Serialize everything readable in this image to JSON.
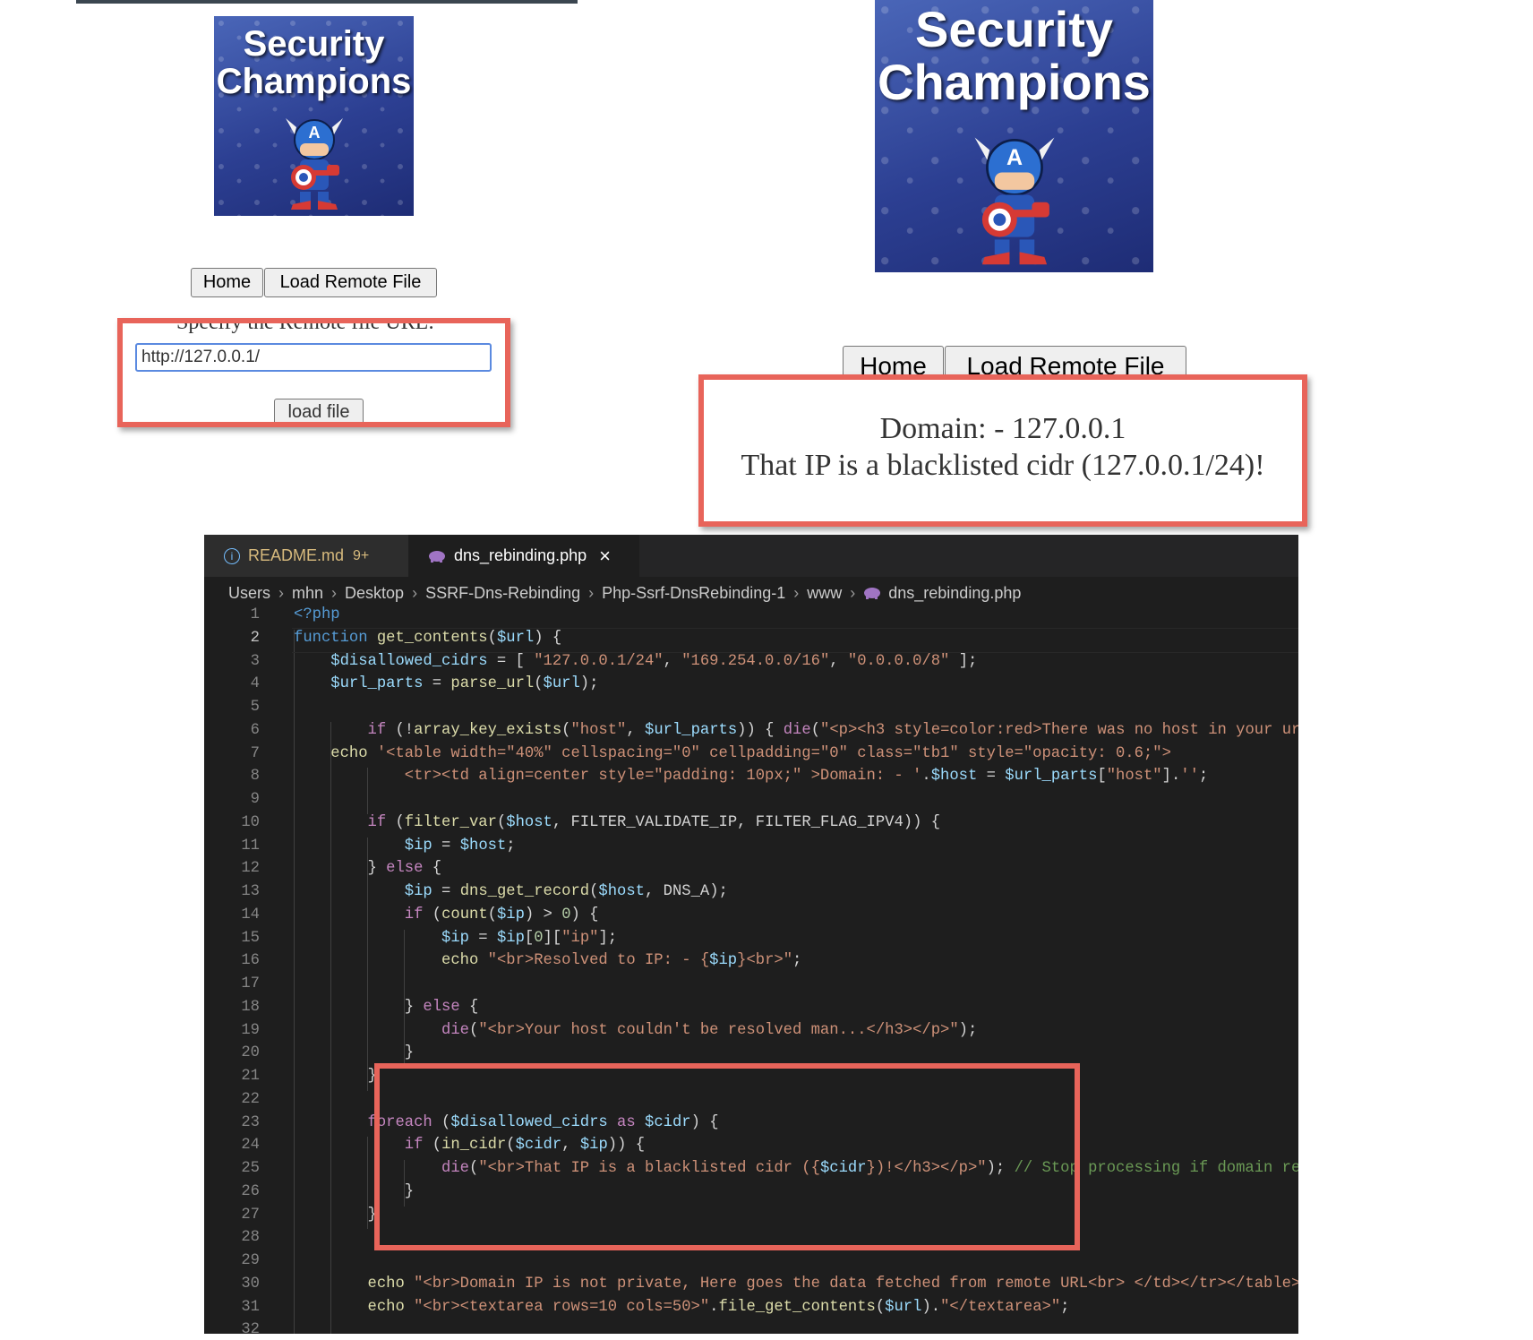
{
  "left_panel": {
    "logo_line1": "Security",
    "logo_line2": "Champions",
    "nav_home": "Home",
    "nav_load": "Load Remote File",
    "prompt_text": "Specify the Remote file URL:",
    "url_value": "http://127.0.0.1/",
    "load_button": "load file"
  },
  "right_panel": {
    "logo_line1": "Security",
    "logo_line2": "Champions",
    "nav_home": "Home",
    "nav_load": "Load Remote File",
    "result_line1": "Domain: - 127.0.0.1",
    "result_line2": "That IP is a blacklisted cidr (127.0.0.1/24)!"
  },
  "editor": {
    "tabs": [
      {
        "label": "README.md",
        "badge": "9+"
      },
      {
        "label": "dns_rebinding.php",
        "close": "×"
      }
    ],
    "breadcrumb": [
      "Users",
      "mhn",
      "Desktop",
      "SSRF-Dns-Rebinding",
      "Php-Ssrf-DnsRebinding-1",
      "www",
      "dns_rebinding.php"
    ],
    "line_numbers": [
      "1",
      "2",
      "3",
      "4",
      "5",
      "6",
      "7",
      "8",
      "9",
      "10",
      "11",
      "12",
      "13",
      "14",
      "15",
      "16",
      "17",
      "18",
      "19",
      "20",
      "21",
      "22",
      "23",
      "24",
      "25",
      "26",
      "27",
      "28",
      "29",
      "30",
      "31",
      "32"
    ],
    "active_line": "2"
  },
  "colors": {
    "highlight_box": "#e8645a",
    "editor_bg": "#1e1e1e",
    "logo_blue": "#2c3f92"
  }
}
